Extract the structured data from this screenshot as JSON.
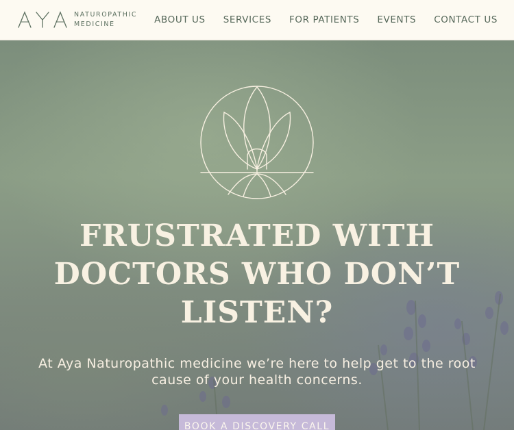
{
  "brand": {
    "mark": "AYA",
    "line1": "NATUROPATHIC",
    "line2": "MEDICINE"
  },
  "nav": {
    "items": [
      "ABOUT US",
      "SERVICES",
      "FOR PATIENTS",
      "EVENTS",
      "CONTACT US"
    ]
  },
  "hero": {
    "headline": "FRUSTRATED WITH DOCTORS WHO DON’T LISTEN?",
    "subtext": "At Aya Naturopathic medicine we’re here to help get to the root cause of your health concerns.",
    "cta_label": "BOOK A DISCOVERY CALL"
  },
  "colors": {
    "header_bg": "#fdfaf2",
    "nav_text": "#56685a",
    "hero_text": "#f8f1e2",
    "cta_bg": "#c6bad9"
  },
  "icons": [
    "aya-logo-icon",
    "lotus-emblem-icon"
  ]
}
